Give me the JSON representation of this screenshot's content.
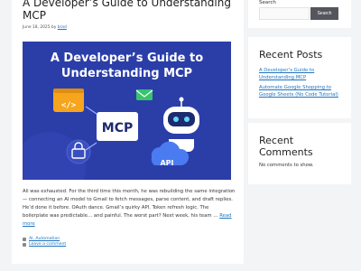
{
  "post": {
    "title": "A Developer’s Guide to Understanding MCP",
    "date": "June 18, 2025",
    "by": "by",
    "author": "brad",
    "hero": {
      "heading_line1": "A Developer’s Guide to",
      "heading_line2": "Understanding MCP",
      "mcp_label": "MCP",
      "api_label": "API",
      "code_label": "</>"
    },
    "excerpt": "Ali was exhausted. For the third time this month, he was rebuilding the same integration — connecting an AI model to Gmail to fetch messages, parse content, and draft replies. He’d done it before. OAuth dance. Gmail’s quirky API. Token refresh logic. The boilerplate was predictable… and painful. The worst part? Next week, his team …",
    "read_more": "Read more",
    "category": "AI, Automation",
    "comment_link": "Leave a comment"
  },
  "sidebar": {
    "search": {
      "label": "Search",
      "placeholder": "",
      "button": "Search"
    },
    "recent_posts": {
      "title": "Recent Posts",
      "items": [
        "A Developer’s Guide to Understanding MCP",
        "Automate Google Shopping to Google Sheets (No Code Tutorial)"
      ]
    },
    "recent_comments": {
      "title": "Recent Comments",
      "empty": "No comments to show."
    }
  },
  "colors": {
    "hero_bg": "#2b3ea8",
    "link": "#1e73be",
    "search_button": "#55555e"
  }
}
